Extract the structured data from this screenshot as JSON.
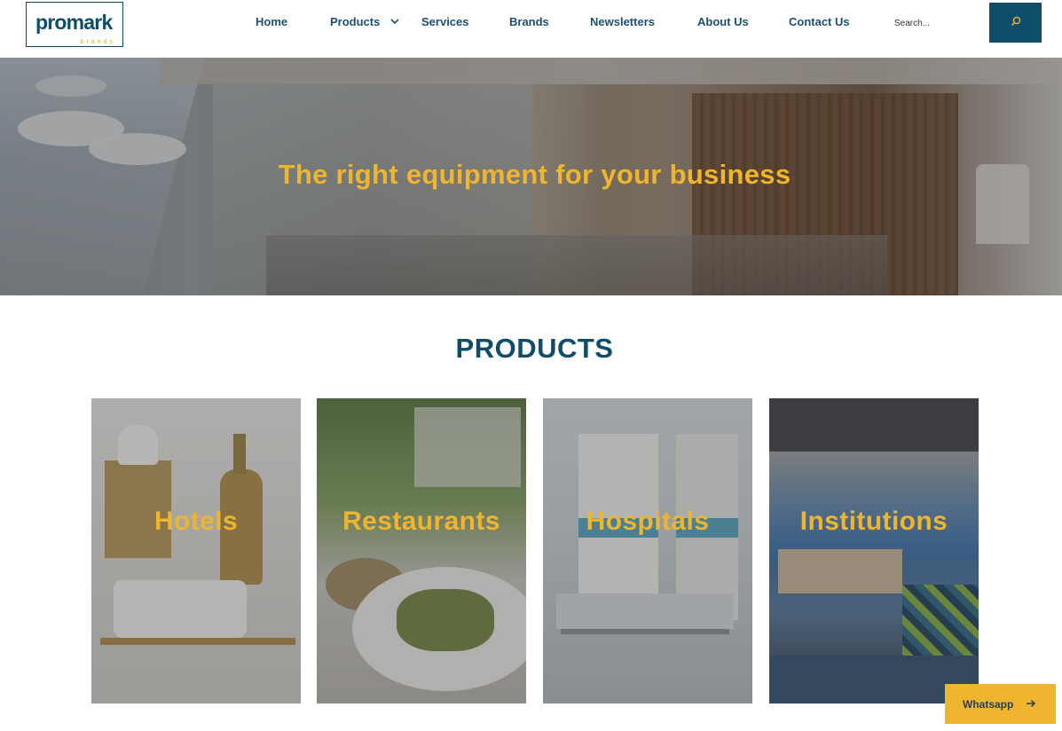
{
  "brand": {
    "name": "promark",
    "tagline": "brands"
  },
  "nav": {
    "items": [
      {
        "label": "Home"
      },
      {
        "label": "Products",
        "has_dropdown": true
      },
      {
        "label": "Services"
      },
      {
        "label": "Brands"
      },
      {
        "label": "Newsletters"
      },
      {
        "label": "About Us"
      },
      {
        "label": "Contact Us"
      }
    ]
  },
  "search": {
    "placeholder": "Search...",
    "button_icon": "search-icon"
  },
  "hero": {
    "title": "The right equipment for your business"
  },
  "products": {
    "heading": "PRODUCTS",
    "cards": [
      {
        "label": "Hotels"
      },
      {
        "label": "Restaurants"
      },
      {
        "label": "Hospitals"
      },
      {
        "label": "Institutions"
      }
    ]
  },
  "whatsapp": {
    "label": "Whatsapp",
    "icon": "arrow-right-icon"
  },
  "colors": {
    "brand_blue": "#0f4d6a",
    "accent_gold": "#f0b52e",
    "nav_text": "#1d4f6e"
  }
}
